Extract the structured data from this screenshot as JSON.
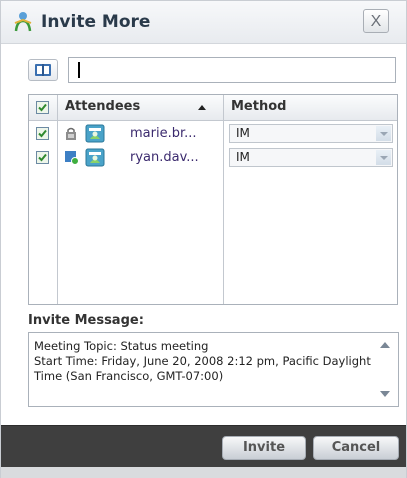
{
  "dialog": {
    "title": "Invite More",
    "close_label": "X"
  },
  "search": {
    "value": "",
    "placeholder": ""
  },
  "table": {
    "columns": [
      "Attendees",
      "Method"
    ],
    "all_checked": true,
    "sort_column": "Attendees",
    "sort_direction": "ascending",
    "rows": [
      {
        "name": "marie.br...",
        "method": "IM",
        "checked": true,
        "status_icon": "lock-icon",
        "avatar_icon": "contact-card-icon"
      },
      {
        "name": "ryan.dav...",
        "method": "IM",
        "checked": true,
        "status_icon": "presence-icon",
        "avatar_icon": "contact-card-icon"
      }
    ]
  },
  "message": {
    "label": "Invite Message:",
    "text": "Meeting Topic: Status meeting\nStart Time: Friday, June 20, 2008 2:12 pm, Pacific Daylight Time (San Francisco, GMT-07:00)"
  },
  "footer": {
    "invite_label": "Invite",
    "cancel_label": "Cancel"
  },
  "colors": {
    "footer_bg": "#3f3f3f",
    "name_text": "#3b2a6e",
    "title_text": "#2a3a4a"
  }
}
